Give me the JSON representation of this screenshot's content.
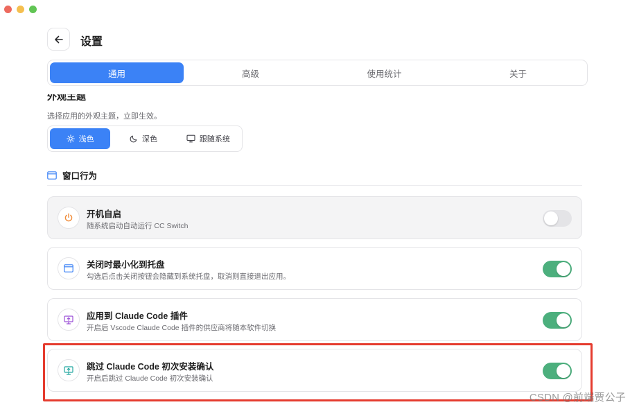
{
  "window": {
    "controls": [
      "close",
      "minimize",
      "zoom"
    ]
  },
  "header": {
    "back_icon": "arrow-left-icon",
    "title": "设置"
  },
  "tabs": [
    {
      "label": "通用",
      "active": true
    },
    {
      "label": "高级",
      "active": false
    },
    {
      "label": "使用统计",
      "active": false
    },
    {
      "label": "关于",
      "active": false
    }
  ],
  "appearance": {
    "heading": "外观主题",
    "description": "选择应用的外观主题，立即生效。",
    "options": [
      {
        "label": "浅色",
        "icon": "sun-icon",
        "active": true
      },
      {
        "label": "深色",
        "icon": "moon-icon",
        "active": false
      },
      {
        "label": "跟随系统",
        "icon": "monitor-icon",
        "active": false
      }
    ]
  },
  "window_behavior": {
    "heading": "窗口行为",
    "icon": "window-icon",
    "settings": [
      {
        "title": "开机自启",
        "description": "随系统启动自动运行 CC Switch",
        "icon": "power-icon",
        "enabled": false
      },
      {
        "title": "关闭时最小化到托盘",
        "description": "勾选后点击关闭按钮会隐藏到系统托盘，取消则直接退出应用。",
        "icon": "window-icon",
        "enabled": true
      },
      {
        "title": "应用到 Claude Code 插件",
        "description": "开启后 Vscode Claude Code 插件的供应商将随本软件切换",
        "icon": "monitor-upload-icon",
        "enabled": true
      },
      {
        "title": "跳过 Claude Code 初次安装确认",
        "description": "开启后跳过 Claude Code 初次安装确认",
        "icon": "monitor-upload-icon",
        "enabled": true
      }
    ]
  },
  "colors": {
    "accent": "#3b82f6",
    "toggle_on": "#4caf7d",
    "annotation": "#e53b2e"
  },
  "watermark": "CSDN @前端贾公子"
}
